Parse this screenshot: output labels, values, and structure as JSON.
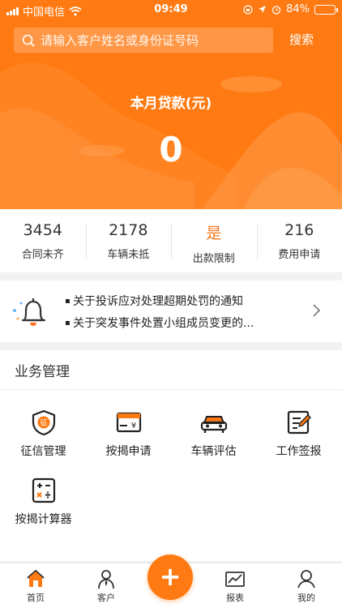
{
  "status_bar": {
    "carrier": "中国电信",
    "time": "09:49",
    "battery": "84%",
    "battery_level": 0.84
  },
  "search": {
    "placeholder": "请输入客户姓名或身份证号码",
    "button": "搜索"
  },
  "loan": {
    "title": "本月贷款(元)",
    "value": "0"
  },
  "stats": [
    {
      "value": "3454",
      "label": "合同未齐"
    },
    {
      "value": "2178",
      "label": "车辆未抵"
    },
    {
      "value": "是",
      "label": "出款限制"
    },
    {
      "value": "216",
      "label": "费用申请"
    }
  ],
  "notices": [
    "关于投诉应对处理超期处罚的通知",
    "关于突发事件处置小组成员变更的..."
  ],
  "business": {
    "title": "业务管理",
    "items": [
      {
        "label": "征信管理",
        "icon": "shield-credit-icon"
      },
      {
        "label": "按揭申请",
        "icon": "payment-card-icon"
      },
      {
        "label": "车辆评估",
        "icon": "car-icon"
      },
      {
        "label": "工作签报",
        "icon": "document-edit-icon"
      },
      {
        "label": "按揭计算器",
        "icon": "calculator-icon"
      }
    ],
    "credit_badge": "征",
    "card_symbol": "¥"
  },
  "tabbar": [
    {
      "label": "首页",
      "icon": "home-icon"
    },
    {
      "label": "客户",
      "icon": "user-icon"
    },
    {
      "label": "报表",
      "icon": "chart-icon"
    },
    {
      "label": "我的",
      "icon": "profile-icon"
    }
  ],
  "fab_symbol": "+",
  "colors": {
    "accent": "#ff7a12",
    "stat_highlight": "#f47a20",
    "background": "#f2f2f2"
  }
}
